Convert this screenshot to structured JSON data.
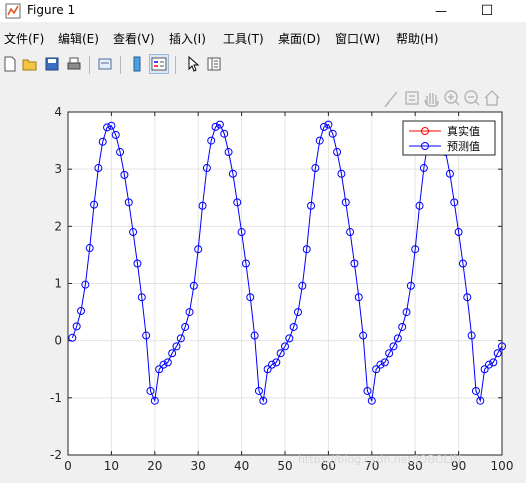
{
  "window": {
    "title": "Figure 1",
    "minimize": "—",
    "maximize": "☐"
  },
  "menu": [
    "文件(F)",
    "编辑(E)",
    "查看(V)",
    "插入(I)",
    "工具(T)",
    "桌面(D)",
    "窗口(W)",
    "帮助(H)"
  ],
  "toolbar": {
    "buttons": [
      "new-figure-icon",
      "open-file-icon",
      "save-icon",
      "print-icon",
      "link-plot-icon",
      "colorbar-icon",
      "legend-icon",
      "edit-plot-arrow-icon",
      "property-inspector-icon"
    ]
  },
  "axes_toolbar": [
    "brush-icon",
    "datatip-icon",
    "pan-hand-icon",
    "zoom-in-icon",
    "zoom-out-icon",
    "home-icon"
  ],
  "watermark": "https://blog.csdn.net/JOBOLIN",
  "chart_data": {
    "type": "line",
    "xlim": [
      0,
      100
    ],
    "ylim": [
      -2,
      4
    ],
    "xticks": [
      0,
      10,
      20,
      30,
      40,
      50,
      60,
      70,
      80,
      90,
      100
    ],
    "yticks": [
      -2,
      -1,
      0,
      1,
      2,
      3,
      4
    ],
    "grid": true,
    "legend_placement": "top-right",
    "colors": {
      "series1": "#ff0000",
      "series2": "#0000ff"
    },
    "series": [
      {
        "name": "真实值",
        "marker": "o",
        "x": [],
        "values": []
      },
      {
        "name": "预测值",
        "marker": "o",
        "x": [
          1,
          2,
          3,
          4,
          5,
          6,
          7,
          8,
          9,
          10,
          11,
          12,
          13,
          14,
          15,
          16,
          17,
          18,
          19,
          20,
          21,
          22,
          23,
          24,
          25,
          26,
          27,
          28,
          29,
          30,
          31,
          32,
          33,
          34,
          35,
          36,
          37,
          38,
          39,
          40,
          41,
          42,
          43,
          44,
          45,
          46,
          47,
          48,
          49,
          50,
          51,
          52,
          53,
          54,
          55,
          56,
          57,
          58,
          59,
          60,
          61,
          62,
          63,
          64,
          65,
          66,
          67,
          68,
          69,
          70,
          71,
          72,
          73,
          74,
          75,
          76,
          77,
          78,
          79,
          80,
          81,
          82,
          83,
          84,
          85,
          86,
          87,
          88,
          89,
          90,
          91,
          92,
          93,
          94,
          95,
          96,
          97,
          98,
          99,
          100
        ],
        "values": [
          0.05,
          0.25,
          0.52,
          0.98,
          1.62,
          2.38,
          3.02,
          3.48,
          3.73,
          3.76,
          3.6,
          3.3,
          2.9,
          2.42,
          1.9,
          1.35,
          0.76,
          0.09,
          -0.88,
          -1.05,
          -0.5,
          -0.42,
          -0.38,
          -0.22,
          -0.1,
          0.04,
          0.24,
          0.5,
          0.96,
          1.6,
          2.36,
          3.02,
          3.5,
          3.74,
          3.78,
          3.62,
          3.3,
          2.92,
          2.42,
          1.9,
          1.35,
          0.76,
          0.09,
          -0.88,
          -1.05,
          -0.5,
          -0.42,
          -0.38,
          -0.22,
          -0.1,
          0.04,
          0.24,
          0.5,
          0.96,
          1.6,
          2.36,
          3.02,
          3.5,
          3.74,
          3.78,
          3.62,
          3.3,
          2.92,
          2.42,
          1.9,
          1.35,
          0.76,
          0.09,
          -0.88,
          -1.05,
          -0.5,
          -0.42,
          -0.38,
          -0.22,
          -0.1,
          0.04,
          0.24,
          0.5,
          0.96,
          1.6,
          2.36,
          3.02,
          3.5,
          3.74,
          3.78,
          3.62,
          3.3,
          2.92,
          2.42,
          1.9,
          1.35,
          0.76,
          0.09,
          -0.88,
          -1.05,
          -0.5,
          -0.42,
          -0.38,
          -0.22,
          -0.1
        ]
      }
    ]
  }
}
